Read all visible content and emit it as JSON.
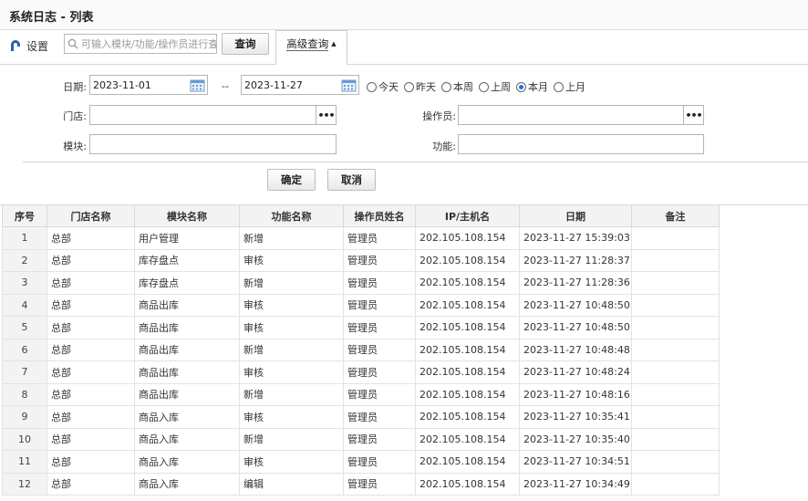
{
  "title": "系统日志 - 列表",
  "toolbar": {
    "settings_label": "设置",
    "search_placeholder": "可输入模块/功能/操作员进行查",
    "search_value": "",
    "query_label": "查询",
    "advanced_label": "高级查询"
  },
  "filter": {
    "date_label": "日期:",
    "date_from": "2023-11-01",
    "date_sep": "--",
    "date_to": "2023-11-27",
    "ranges": [
      "今天",
      "昨天",
      "本周",
      "上周",
      "本月",
      "上月"
    ],
    "selected_range": "本月",
    "store_label": "门店:",
    "store_value": "",
    "operator_label": "操作员:",
    "operator_value": "",
    "module_label": "模块:",
    "module_value": "",
    "function_label": "功能:",
    "function_value": "",
    "ok_label": "确定",
    "cancel_label": "取消",
    "more_glyph": "•••"
  },
  "table": {
    "columns": [
      "序号",
      "门店名称",
      "模块名称",
      "功能名称",
      "操作员姓名",
      "IP/主机名",
      "日期",
      "备注"
    ],
    "rows": [
      [
        "1",
        "总部",
        "用户管理",
        "新增",
        "管理员",
        "202.105.108.154",
        "2023-11-27 15:39:03",
        ""
      ],
      [
        "2",
        "总部",
        "库存盘点",
        "审核",
        "管理员",
        "202.105.108.154",
        "2023-11-27 11:28:37",
        ""
      ],
      [
        "3",
        "总部",
        "库存盘点",
        "新增",
        "管理员",
        "202.105.108.154",
        "2023-11-27 11:28:36",
        ""
      ],
      [
        "4",
        "总部",
        "商品出库",
        "审核",
        "管理员",
        "202.105.108.154",
        "2023-11-27 10:48:50",
        ""
      ],
      [
        "5",
        "总部",
        "商品出库",
        "审核",
        "管理员",
        "202.105.108.154",
        "2023-11-27 10:48:50",
        ""
      ],
      [
        "6",
        "总部",
        "商品出库",
        "新增",
        "管理员",
        "202.105.108.154",
        "2023-11-27 10:48:48",
        ""
      ],
      [
        "7",
        "总部",
        "商品出库",
        "审核",
        "管理员",
        "202.105.108.154",
        "2023-11-27 10:48:24",
        ""
      ],
      [
        "8",
        "总部",
        "商品出库",
        "新增",
        "管理员",
        "202.105.108.154",
        "2023-11-27 10:48:16",
        ""
      ],
      [
        "9",
        "总部",
        "商品入库",
        "审核",
        "管理员",
        "202.105.108.154",
        "2023-11-27 10:35:41",
        ""
      ],
      [
        "10",
        "总部",
        "商品入库",
        "新增",
        "管理员",
        "202.105.108.154",
        "2023-11-27 10:35:40",
        ""
      ],
      [
        "11",
        "总部",
        "商品入库",
        "审核",
        "管理员",
        "202.105.108.154",
        "2023-11-27 10:34:51",
        ""
      ],
      [
        "12",
        "总部",
        "商品入库",
        "编辑",
        "管理员",
        "202.105.108.154",
        "2023-11-27 10:34:49",
        ""
      ]
    ]
  },
  "colors": {
    "accent": "#1a73e8",
    "header_bg": "#f3f3f3",
    "border": "#d9d9d9"
  }
}
